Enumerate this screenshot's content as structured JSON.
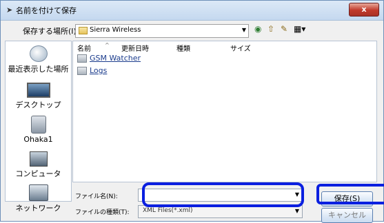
{
  "window": {
    "title": "名前を付けて保存",
    "close_label": "x"
  },
  "toolbar": {
    "save_in_label": "保存する場所(I):",
    "current_folder": "Sierra Wireless"
  },
  "places": [
    {
      "label": "最近表示した場所",
      "icon": "recent-places-icon"
    },
    {
      "label": "デスクトップ",
      "icon": "desktop-icon"
    },
    {
      "label": "Ohaka1",
      "icon": "user-folder-icon"
    },
    {
      "label": "コンピュータ",
      "icon": "computer-icon"
    },
    {
      "label": "ネットワーク",
      "icon": "network-icon"
    }
  ],
  "columns": [
    "名前",
    "更新日時",
    "種類",
    "サイズ"
  ],
  "files": [
    {
      "name": "GSM Watcher"
    },
    {
      "name": "Logs"
    }
  ],
  "filename": {
    "label": "ファイル名(N):",
    "value": ""
  },
  "filetype": {
    "label": "ファイルの種類(T):",
    "value": "XML Files(*.xml)"
  },
  "buttons": {
    "save": "保存(S)",
    "cancel": "キャンセル"
  },
  "highlight_color": "#0a1fe0"
}
